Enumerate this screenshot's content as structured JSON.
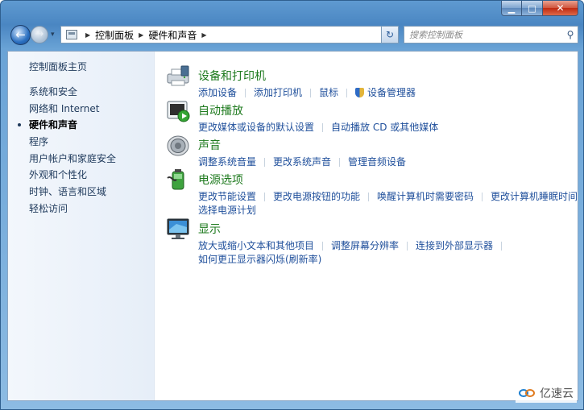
{
  "window": {
    "minimize_glyph": "▁",
    "maximize_glyph": "□",
    "close_glyph": "✕"
  },
  "nav": {
    "back_glyph": "←",
    "forward_glyph": "→",
    "dropdown_glyph": "▾",
    "refresh_glyph": "↻",
    "breadcrumbs": [
      "控制面板",
      "硬件和声音"
    ],
    "search_placeholder": "搜索控制面板"
  },
  "sidebar": {
    "title": "控制面板主页",
    "items": [
      {
        "label": "系统和安全"
      },
      {
        "label": "网络和 Internet"
      },
      {
        "label": "硬件和声音",
        "active": true
      },
      {
        "label": "程序"
      },
      {
        "label": "用户帐户和家庭安全"
      },
      {
        "label": "外观和个性化"
      },
      {
        "label": "时钟、语言和区域"
      },
      {
        "label": "轻松访问"
      }
    ]
  },
  "categories": [
    {
      "title": "设备和打印机",
      "icon": "printer-icon",
      "links": [
        "添加设备",
        "添加打印机",
        "鼠标",
        "设备管理器"
      ],
      "links_line2": []
    },
    {
      "title": "自动播放",
      "icon": "autoplay-icon",
      "links": [
        "更改媒体或设备的默认设置",
        "自动播放 CD 或其他媒体"
      ],
      "links_line2": []
    },
    {
      "title": "声音",
      "icon": "speaker-icon",
      "links": [
        "调整系统音量",
        "更改系统声音",
        "管理音频设备"
      ],
      "links_line2": []
    },
    {
      "title": "电源选项",
      "icon": "battery-icon",
      "links": [
        "更改节能设置",
        "更改电源按钮的功能",
        "唤醒计算机时需要密码",
        "更改计算机睡眠时间"
      ],
      "links_line2": [
        "选择电源计划"
      ]
    },
    {
      "title": "显示",
      "icon": "monitor-icon",
      "links": [
        "放大或缩小文本和其他项目",
        "调整屏幕分辨率",
        "连接到外部显示器"
      ],
      "links_line2": [
        "如何更正显示器闪烁(刷新率)"
      ]
    }
  ],
  "watermark": {
    "text": "亿速云"
  }
}
